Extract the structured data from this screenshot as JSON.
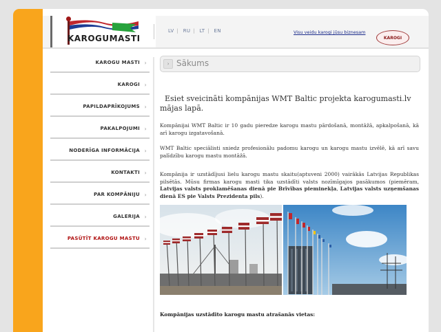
{
  "header": {
    "logo_text": "KAROGUMASTI",
    "languages": [
      "LV",
      "RU",
      "LT",
      "EN"
    ],
    "link": "Visu veidu karogi jūsu biznesam",
    "seal_text": "KAROGI"
  },
  "sidebar": {
    "items": [
      {
        "label": "KAROGU MASTI"
      },
      {
        "label": "KAROGI"
      },
      {
        "label": "PAPILDAPRĪKOJUMS"
      },
      {
        "label": "PAKALPOJUMI"
      },
      {
        "label": "NODERĪGA INFORMĀCIJA"
      },
      {
        "label": "KONTAKTI"
      },
      {
        "label": "PAR KOMPĀNIJU"
      },
      {
        "label": "GALERIJA"
      },
      {
        "label": "PASŪTĪT KAROGU MASTU"
      }
    ],
    "active_index": 8
  },
  "main": {
    "title": "Sākums",
    "welcome": "Esiet sveicināti kompānijas WMT Baltic projekta karogumasti.lv mājas lapā.",
    "para1": "Kompānijai WMT Baltic ir 10 gadu pieredze karogu mastu pārdošanā, montāžā, apkalpošanā, kā arī karogu izgatavošanā.",
    "para2": "WMT Baltic speciālisti sniedz profesionālu padomu karogu un karogu mastu izvēlē, kā arī savu palīdzību karogu mastu montāžā.",
    "para3_a": "Kompānija ir uzstādījusi lielu karogu mastu skaitu(aptuveni 2000) vairākās Latvijas Republikas pilsētās. Mūsu firmas karogu masti tika uzstādīti valsts nozīmīgajos pasākumos (piemēram, ",
    "para3_bold1": "Latvijas valsts proklamēšanas dienā pie Brīvības pieminekļa",
    "para3_mid": ", ",
    "para3_bold2": "Latvijas valsts uzņemšanas dienā ES pie Valsts Prezidenta pils",
    "para3_end": ").",
    "bottom_heading": "Kompānijas uzstādīto karogu mastu atrašanās vietas:"
  },
  "colors": {
    "orange": "#f9a51c",
    "active_nav": "#b01212",
    "link": "#1a2a8a",
    "flag_red": "#9e2a2b"
  }
}
